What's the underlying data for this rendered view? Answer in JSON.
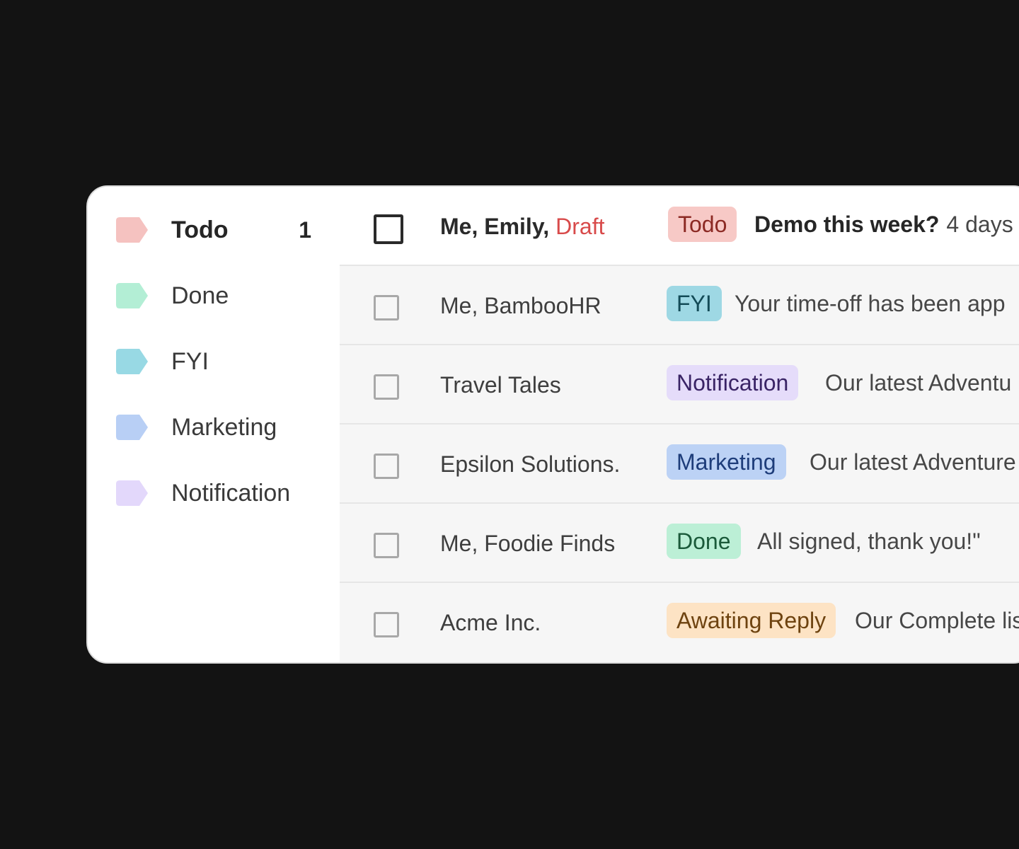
{
  "sidebar": {
    "labels": [
      {
        "name": "Todo",
        "count": "1",
        "color": "#f5c2c0",
        "active": true
      },
      {
        "name": "Done",
        "count": "",
        "color": "#b3eed5"
      },
      {
        "name": "FYI",
        "count": "",
        "color": "#98d9e4"
      },
      {
        "name": "Marketing",
        "count": "",
        "color": "#b8cff5"
      },
      {
        "name": "Notification",
        "count": "",
        "color": "#e3d8fb"
      }
    ]
  },
  "emails": [
    {
      "sender": "Me, Emily,",
      "draft": "Draft",
      "tag": "Todo",
      "tag_bg": "#f7c9c6",
      "tag_fg": "#8c2a24",
      "subject": "Demo this week?",
      "preview": "4 days"
    },
    {
      "sender": "Me, BambooHR",
      "draft": "",
      "tag": "FYI",
      "tag_bg": "#9ed8e4",
      "tag_fg": "#134b57",
      "subject": "",
      "preview": "Your time-off has been app"
    },
    {
      "sender": "Travel Tales",
      "draft": "",
      "tag": "Notification",
      "tag_bg": "#e5dcfa",
      "tag_fg": "#3a2466",
      "subject": "",
      "preview": "Our latest Adventu"
    },
    {
      "sender": "Epsilon Solutions.",
      "draft": "",
      "tag": "Marketing",
      "tag_bg": "#bcd2f5",
      "tag_fg": "#1e3d7a",
      "subject": "",
      "preview": "Our latest Adventure"
    },
    {
      "sender": "Me, Foodie Finds",
      "draft": "",
      "tag": "Done",
      "tag_bg": "#bcefd6",
      "tag_fg": "#1b5a3a",
      "subject": "",
      "preview": "All signed, thank you!\""
    },
    {
      "sender": "Acme Inc.",
      "draft": "",
      "tag": "Awaiting Reply",
      "tag_bg": "#fde3c4",
      "tag_fg": "#6e4310",
      "subject": "",
      "preview": "Our Complete lis"
    }
  ]
}
